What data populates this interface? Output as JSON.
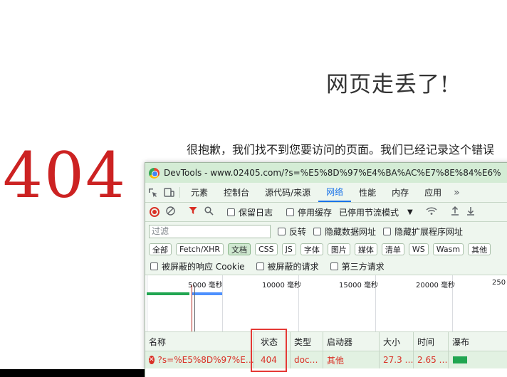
{
  "page": {
    "heading": "网页走丢了!",
    "message": "很抱歉，我们找不到您要访问的页面。我们已经记录这个错误",
    "error_code": "404"
  },
  "devtools": {
    "title": "DevTools - www.02405.com/?s=%E5%8D%97%E4%BA%AC%E7%8E%84%E6%",
    "tabs": [
      {
        "label": "元素"
      },
      {
        "label": "控制台"
      },
      {
        "label": "源代码/来源"
      },
      {
        "label": "网络",
        "active": true
      },
      {
        "label": "性能"
      },
      {
        "label": "内存"
      },
      {
        "label": "应用"
      }
    ],
    "toolbar": {
      "preserve_log": "保留日志",
      "disable_cache": "停用缓存",
      "throttling": "已停用节流模式"
    },
    "filter": {
      "placeholder": "过滤",
      "invert": "反转",
      "hide_data_urls": "隐藏数据网址",
      "hide_extension_urls": "隐藏扩展程序网址"
    },
    "type_filters": [
      "全部",
      "Fetch/XHR",
      "文档",
      "CSS",
      "JS",
      "字体",
      "图片",
      "媒体",
      "清单",
      "WS",
      "Wasm",
      "其他"
    ],
    "active_type_filter": "文档",
    "cookie_row": {
      "blocked_response_cookies": "被屏蔽的响应 Cookie",
      "blocked_requests": "被屏蔽的请求",
      "third_party_requests": "第三方请求"
    },
    "overview": {
      "ticks": [
        "5000 毫秒",
        "10000 毫秒",
        "15000 毫秒",
        "20000 毫秒",
        "250"
      ]
    },
    "table": {
      "headers": [
        "名称",
        "状态",
        "类型",
        "启动器",
        "大小",
        "时间",
        "瀑布"
      ],
      "rows": [
        {
          "name": "?s=%E5%8D%97%E…",
          "status": "404",
          "type": "doc…",
          "initiator": "其他",
          "size": "27.3 …",
          "time": "2.65 …"
        }
      ]
    },
    "colors": {
      "title_bg": "#d4ecd5",
      "panel_bg": "#eef6ee",
      "error_red": "#d93025",
      "accent_blue": "#1a73e8",
      "highlight_border": "#e53935"
    }
  }
}
